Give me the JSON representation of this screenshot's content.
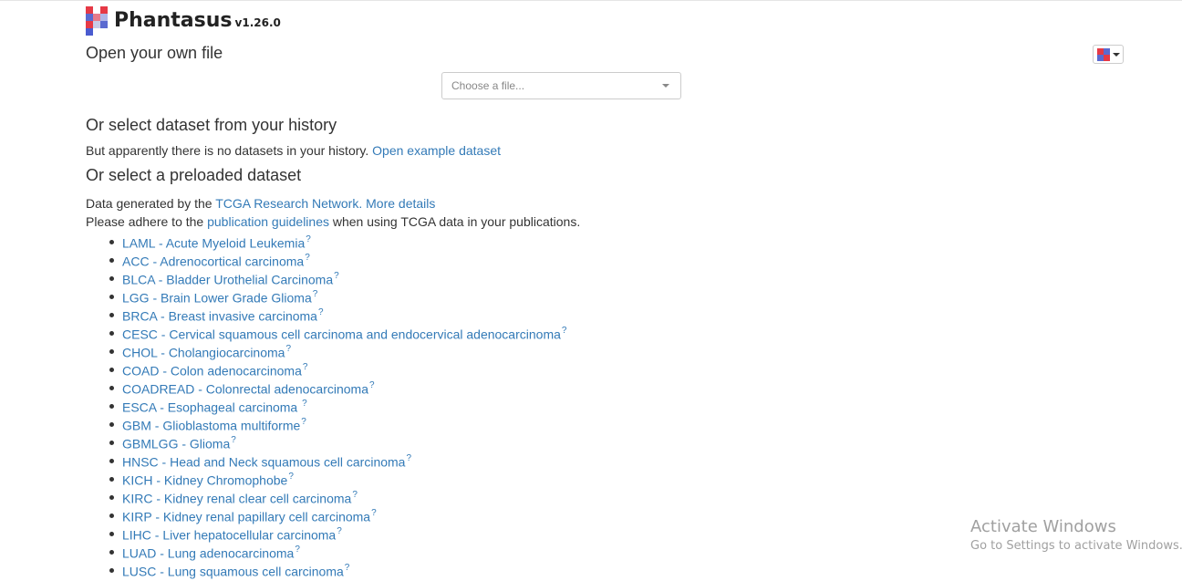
{
  "app": {
    "name": "Phantasus",
    "version": "v1.26.0"
  },
  "logo_colors": [
    "#e63946",
    "#ffffff",
    "#e63946",
    "#5b6ad0",
    "#e87a8a",
    "#b0b6e8",
    "#e63946",
    "#c7cbe8",
    "#5b6ad0",
    "#4a5bd0",
    "#ffffff",
    "#ffffff"
  ],
  "flag_colors": [
    "#e63946",
    "#5b6ad0",
    "#5b6ad0",
    "#e63946"
  ],
  "sections": {
    "open_file": {
      "heading": "Open your own file",
      "file_placeholder": "Choose a file..."
    },
    "history": {
      "heading": "Or select dataset from your history",
      "message": "But apparently there is no datasets in your history.",
      "example_link": "Open example dataset"
    },
    "preloaded": {
      "heading": "Or select a preloaded dataset",
      "generated_prefix": "Data generated by the",
      "tcga_link": "TCGA Research Network.",
      "details_link": "More details",
      "adhere_prefix": "Please adhere to the",
      "guidelines_link": "publication guidelines",
      "adhere_suffix": "when using TCGA data in your publications."
    }
  },
  "datasets": [
    {
      "label": "LAML - Acute Myeloid Leukemia",
      "help": "?"
    },
    {
      "label": "ACC - Adrenocortical carcinoma",
      "help": "?"
    },
    {
      "label": "BLCA - Bladder Urothelial Carcinoma",
      "help": "?"
    },
    {
      "label": "LGG - Brain Lower Grade Glioma",
      "help": "?"
    },
    {
      "label": "BRCA - Breast invasive carcinoma",
      "help": "?"
    },
    {
      "label": "CESC - Cervical squamous cell carcinoma and endocervical adenocarcinoma",
      "help": "?"
    },
    {
      "label": "CHOL - Cholangiocarcinoma",
      "help": "?"
    },
    {
      "label": "COAD - Colon adenocarcinoma",
      "help": "?"
    },
    {
      "label": "COADREAD - Colonrectal adenocarcinoma",
      "help": "?"
    },
    {
      "label": "ESCA - Esophageal carcinoma ",
      "help": "?"
    },
    {
      "label": "GBM - Glioblastoma multiforme",
      "help": "?"
    },
    {
      "label": "GBMLGG - Glioma",
      "help": "?"
    },
    {
      "label": "HNSC - Head and Neck squamous cell carcinoma",
      "help": "?"
    },
    {
      "label": "KICH - Kidney Chromophobe",
      "help": "?"
    },
    {
      "label": "KIRC - Kidney renal clear cell carcinoma",
      "help": "?"
    },
    {
      "label": "KIRP - Kidney renal papillary cell carcinoma",
      "help": "?"
    },
    {
      "label": "LIHC - Liver hepatocellular carcinoma",
      "help": "?"
    },
    {
      "label": "LUAD - Lung adenocarcinoma",
      "help": "?"
    },
    {
      "label": "LUSC - Lung squamous cell carcinoma",
      "help": "?"
    }
  ],
  "watermark": {
    "title": "Activate Windows",
    "subtitle": "Go to Settings to activate Windows."
  }
}
